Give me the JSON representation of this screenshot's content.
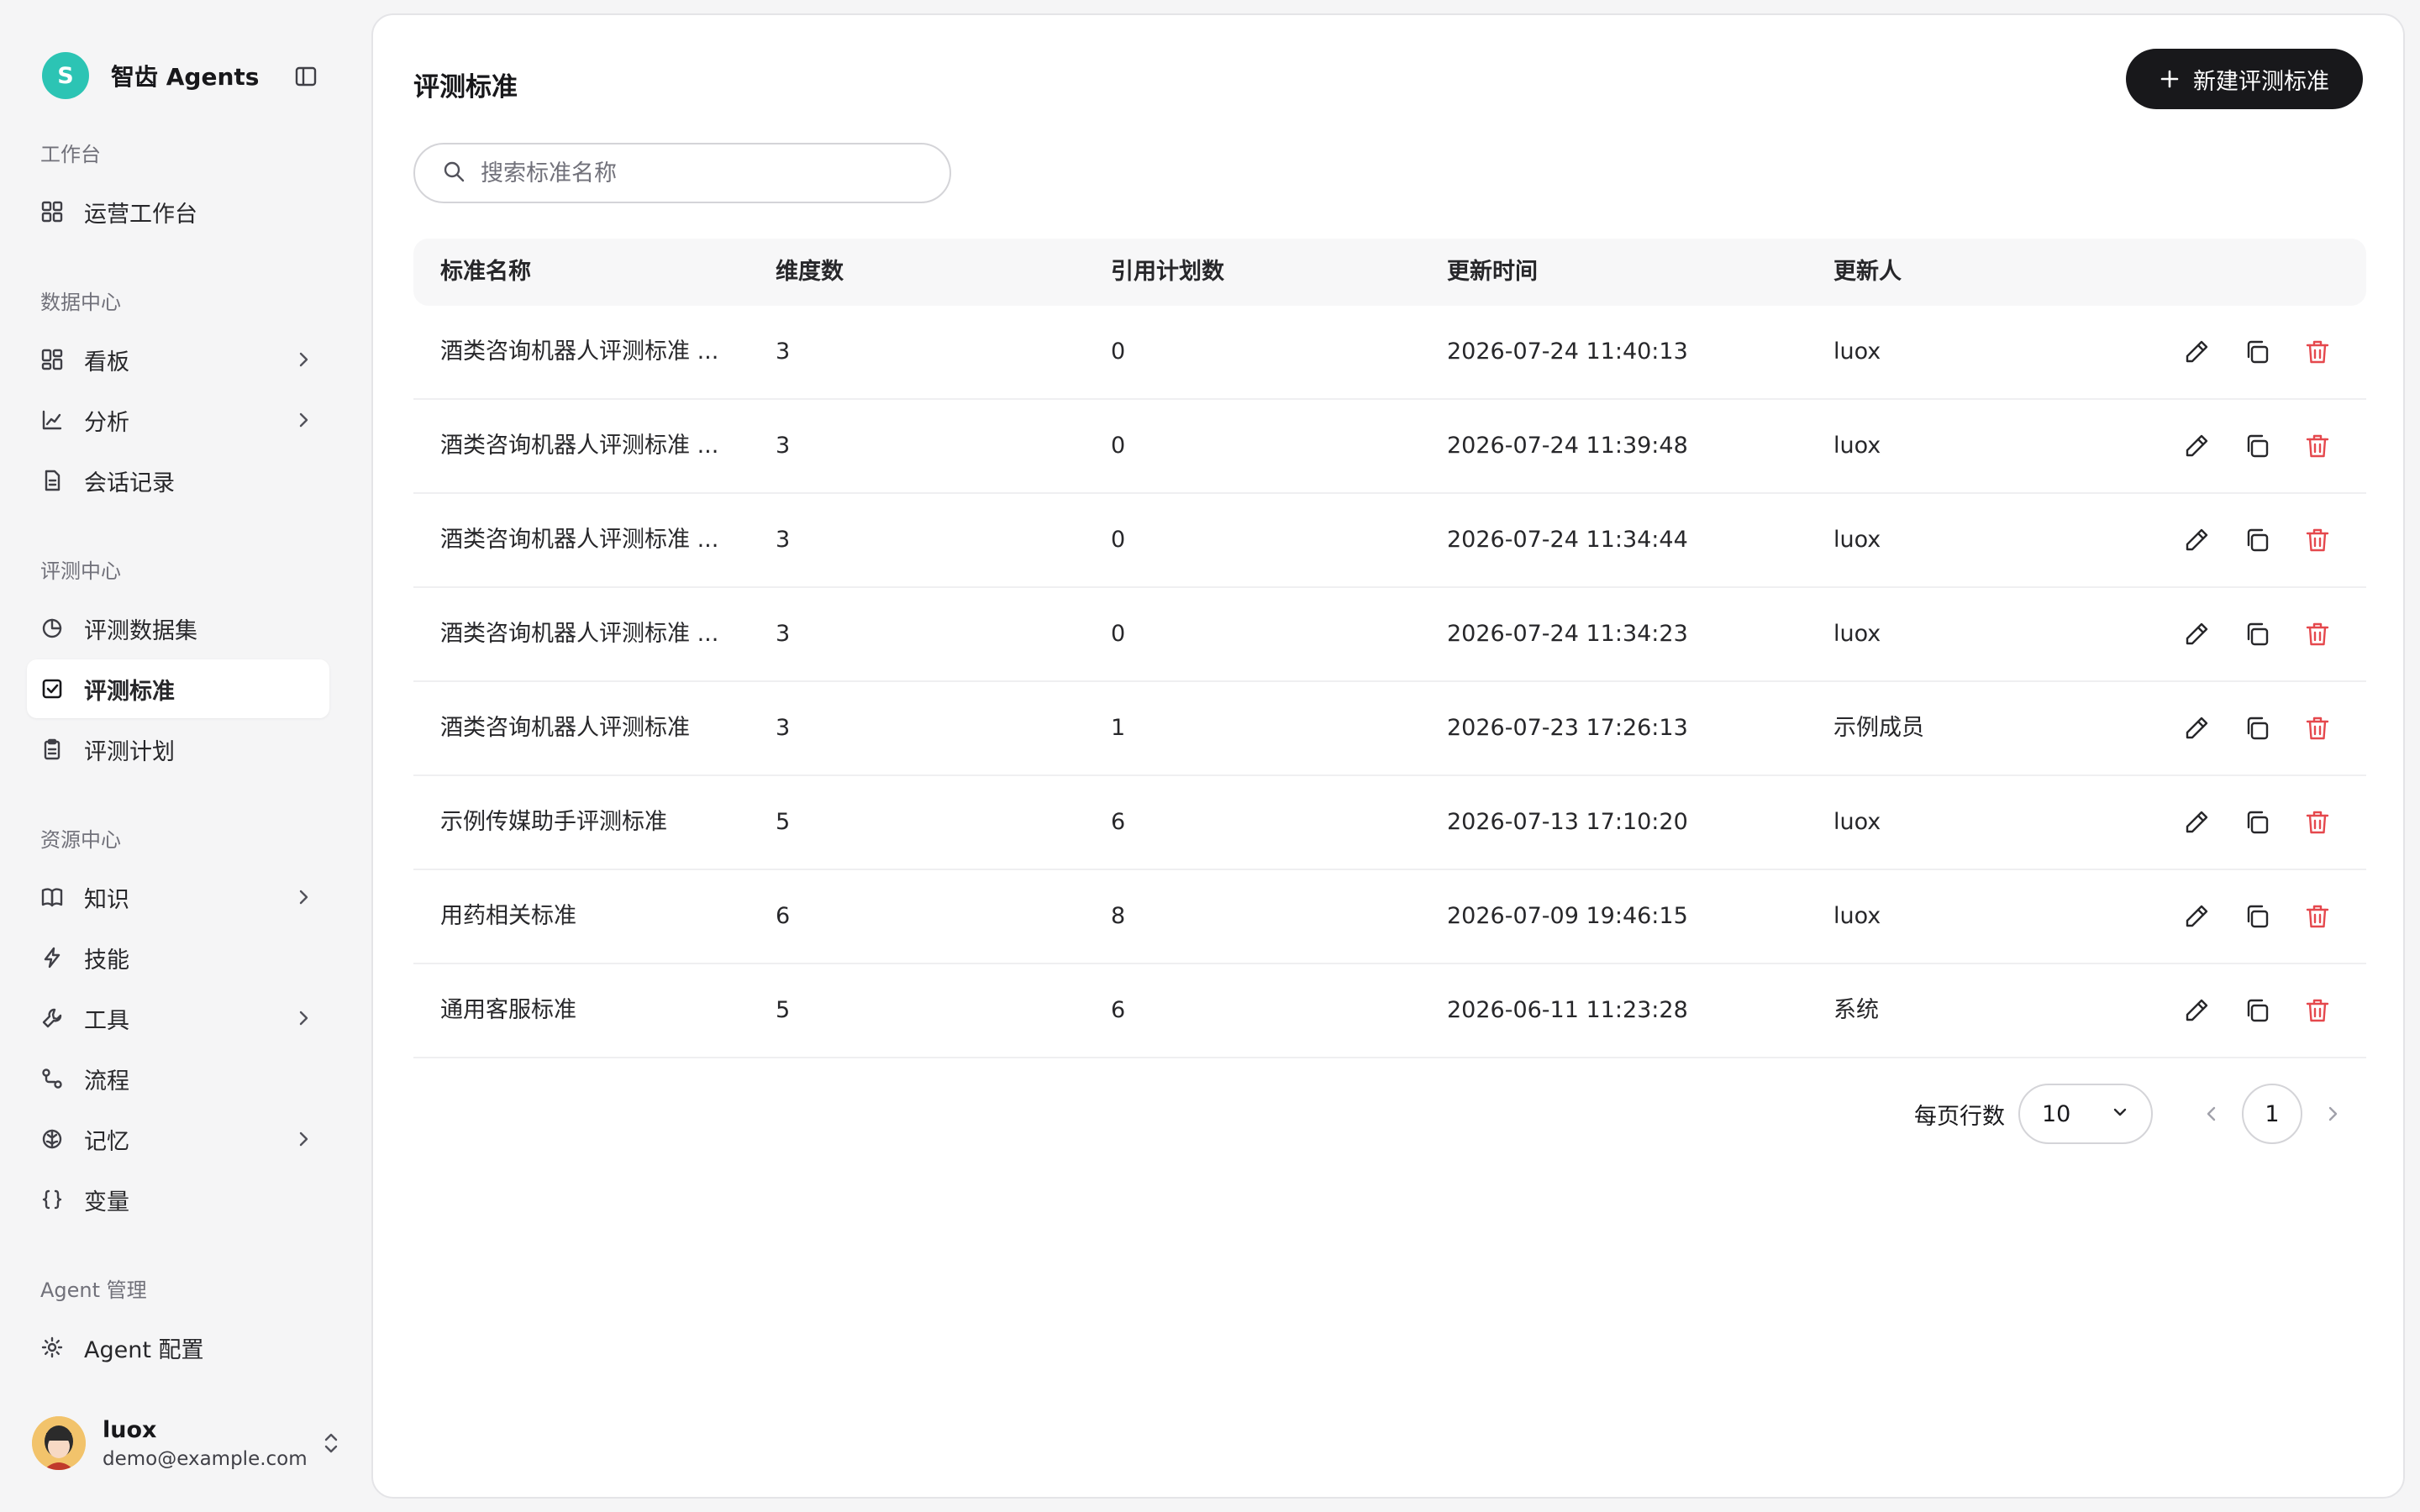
{
  "brand": {
    "logo_letter": "S",
    "name": "智齿 Agents"
  },
  "sidebar": {
    "sections": [
      {
        "title": "工作台",
        "items": [
          {
            "label": "运营工作台",
            "icon": "dashboard-grid-icon",
            "chevron": false
          }
        ]
      },
      {
        "title": "数据中心",
        "items": [
          {
            "label": "看板",
            "icon": "board-grid-icon",
            "chevron": true
          },
          {
            "label": "分析",
            "icon": "line-chart-icon",
            "chevron": true
          },
          {
            "label": "会话记录",
            "icon": "document-icon",
            "chevron": false
          }
        ]
      },
      {
        "title": "评测中心",
        "items": [
          {
            "label": "评测数据集",
            "icon": "pie-chart-icon",
            "chevron": false
          },
          {
            "label": "评测标准",
            "icon": "checkbox-icon",
            "chevron": false,
            "active": true
          },
          {
            "label": "评测计划",
            "icon": "clipboard-icon",
            "chevron": false
          }
        ]
      },
      {
        "title": "资源中心",
        "items": [
          {
            "label": "知识",
            "icon": "book-icon",
            "chevron": true
          },
          {
            "label": "技能",
            "icon": "lightning-icon",
            "chevron": false
          },
          {
            "label": "工具",
            "icon": "wrench-icon",
            "chevron": true
          },
          {
            "label": "流程",
            "icon": "workflow-icon",
            "chevron": false
          },
          {
            "label": "记忆",
            "icon": "brain-icon",
            "chevron": true
          },
          {
            "label": "变量",
            "icon": "braces-icon",
            "chevron": false
          }
        ]
      },
      {
        "title": "Agent 管理",
        "items": [
          {
            "label": "Agent 配置",
            "icon": "gear-icon",
            "chevron": false
          }
        ]
      }
    ]
  },
  "user": {
    "name": "luox",
    "email": "demo@example.com"
  },
  "main": {
    "title": "评测标准",
    "new_button_label": "新建评测标准",
    "search_placeholder": "搜索标准名称",
    "columns": [
      "标准名称",
      "维度数",
      "引用计划数",
      "更新时间",
      "更新人"
    ],
    "rows": [
      {
        "name": "酒类咨询机器人评测标准 ...",
        "dimensions": "3",
        "plans": "0",
        "updated_at": "2026-07-24 11:40:13",
        "updated_by": "luox"
      },
      {
        "name": "酒类咨询机器人评测标准 ...",
        "dimensions": "3",
        "plans": "0",
        "updated_at": "2026-07-24 11:39:48",
        "updated_by": "luox"
      },
      {
        "name": "酒类咨询机器人评测标准 ...",
        "dimensions": "3",
        "plans": "0",
        "updated_at": "2026-07-24 11:34:44",
        "updated_by": "luox"
      },
      {
        "name": "酒类咨询机器人评测标准 ...",
        "dimensions": "3",
        "plans": "0",
        "updated_at": "2026-07-24 11:34:23",
        "updated_by": "luox"
      },
      {
        "name": "酒类咨询机器人评测标准",
        "dimensions": "3",
        "plans": "1",
        "updated_at": "2026-07-23 17:26:13",
        "updated_by": "示例成员"
      },
      {
        "name": "示例传媒助手评测标准",
        "dimensions": "5",
        "plans": "6",
        "updated_at": "2026-07-13 17:10:20",
        "updated_by": "luox"
      },
      {
        "name": "用药相关标准",
        "dimensions": "6",
        "plans": "8",
        "updated_at": "2026-07-09 19:46:15",
        "updated_by": "luox"
      },
      {
        "name": "通用客服标准",
        "dimensions": "5",
        "plans": "6",
        "updated_at": "2026-06-11 11:23:28",
        "updated_by": "系统"
      }
    ]
  },
  "pagination": {
    "rows_per_page_label": "每页行数",
    "rows_per_page": "10",
    "current_page": "1"
  },
  "colors": {
    "accent": "#2cc4b4",
    "primary_button": "#18181b",
    "danger": "#e5484d"
  }
}
